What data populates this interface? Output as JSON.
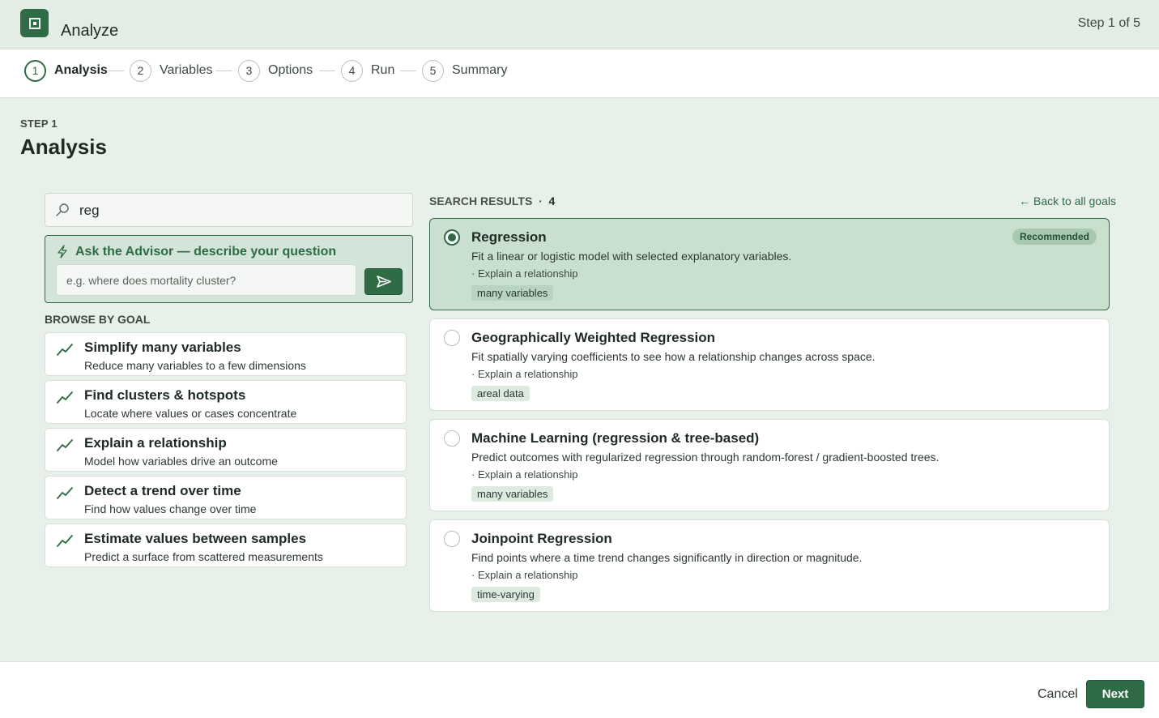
{
  "app": {
    "title": "Analyze",
    "step_count": "Step 1 of 5"
  },
  "stepper": [
    {
      "num": "1",
      "label": "Analysis"
    },
    {
      "num": "2",
      "label": "Variables"
    },
    {
      "num": "3",
      "label": "Options"
    },
    {
      "num": "4",
      "label": "Run"
    },
    {
      "num": "5",
      "label": "Summary"
    }
  ],
  "page": {
    "eyebrow": "STEP 1",
    "title": "Analysis"
  },
  "search": {
    "value": "reg"
  },
  "advisor": {
    "title": "Ask the Advisor — describe your question",
    "placeholder": "e.g. where does mortality cluster?"
  },
  "browse": {
    "label": "BROWSE BY GOAL",
    "goals": [
      {
        "title": "Simplify many variables",
        "desc": "Reduce many variables to a few dimensions"
      },
      {
        "title": "Find clusters & hotspots",
        "desc": "Locate where values or cases concentrate"
      },
      {
        "title": "Explain a relationship",
        "desc": "Model how variables drive an outcome"
      },
      {
        "title": "Detect a trend over time",
        "desc": "Find how values change over time"
      },
      {
        "title": "Estimate values between samples",
        "desc": "Predict a surface from scattered measurements"
      }
    ]
  },
  "results": {
    "label": "SEARCH RESULTS",
    "sep": "·",
    "count": "4",
    "back_link": "← Back to all goals",
    "items": [
      {
        "title": "Regression",
        "desc": "Fit a linear or logistic model with selected explanatory variables.",
        "goal": "· Explain a relationship",
        "tag": "many variables",
        "badge": "Recommended"
      },
      {
        "title": "Geographically Weighted Regression",
        "desc": "Fit spatially varying coefficients to see how a relationship changes across space.",
        "goal": "· Explain a relationship",
        "tag": "areal data"
      },
      {
        "title": "Machine Learning (regression & tree-based)",
        "desc": "Predict outcomes with regularized regression through random-forest / gradient-boosted trees.",
        "goal": "· Explain a relationship",
        "tag": "many variables"
      },
      {
        "title": "Joinpoint Regression",
        "desc": "Find points where a time trend changes significantly in direction or magnitude.",
        "goal": "· Explain a relationship",
        "tag": "time-varying"
      }
    ]
  },
  "footer": {
    "cancel": "Cancel",
    "next": "Next"
  },
  "colors": {
    "accent": "#2f6b45",
    "background": "#e8f0ea",
    "selected": "#c9e0cf"
  }
}
